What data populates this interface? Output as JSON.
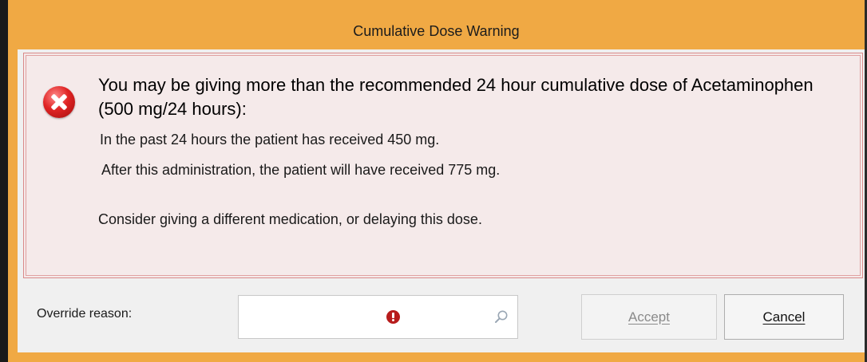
{
  "window": {
    "title": "Cumulative Dose Warning"
  },
  "message": {
    "headline": "You may be giving more than the recommended 24 hour cumulative dose of Acetaminophen (500 mg/24 hours):",
    "line_received": "In the past 24 hours the patient has received 450 mg.",
    "line_after": "After this administration, the patient will have received 775 mg.",
    "line_consider": "Consider giving a different medication, or delaying this dose.",
    "icon": "error-icon"
  },
  "override": {
    "label": "Override reason:",
    "value": "",
    "required_icon": "required-indicator-icon",
    "search_icon": "search-icon"
  },
  "buttons": {
    "accept_label": "Accept",
    "cancel_label": "Cancel"
  },
  "colors": {
    "frame": "#f0a944",
    "message_background": "#f5eaea",
    "message_border": "#d98a8a",
    "error_red": "#e02424"
  }
}
